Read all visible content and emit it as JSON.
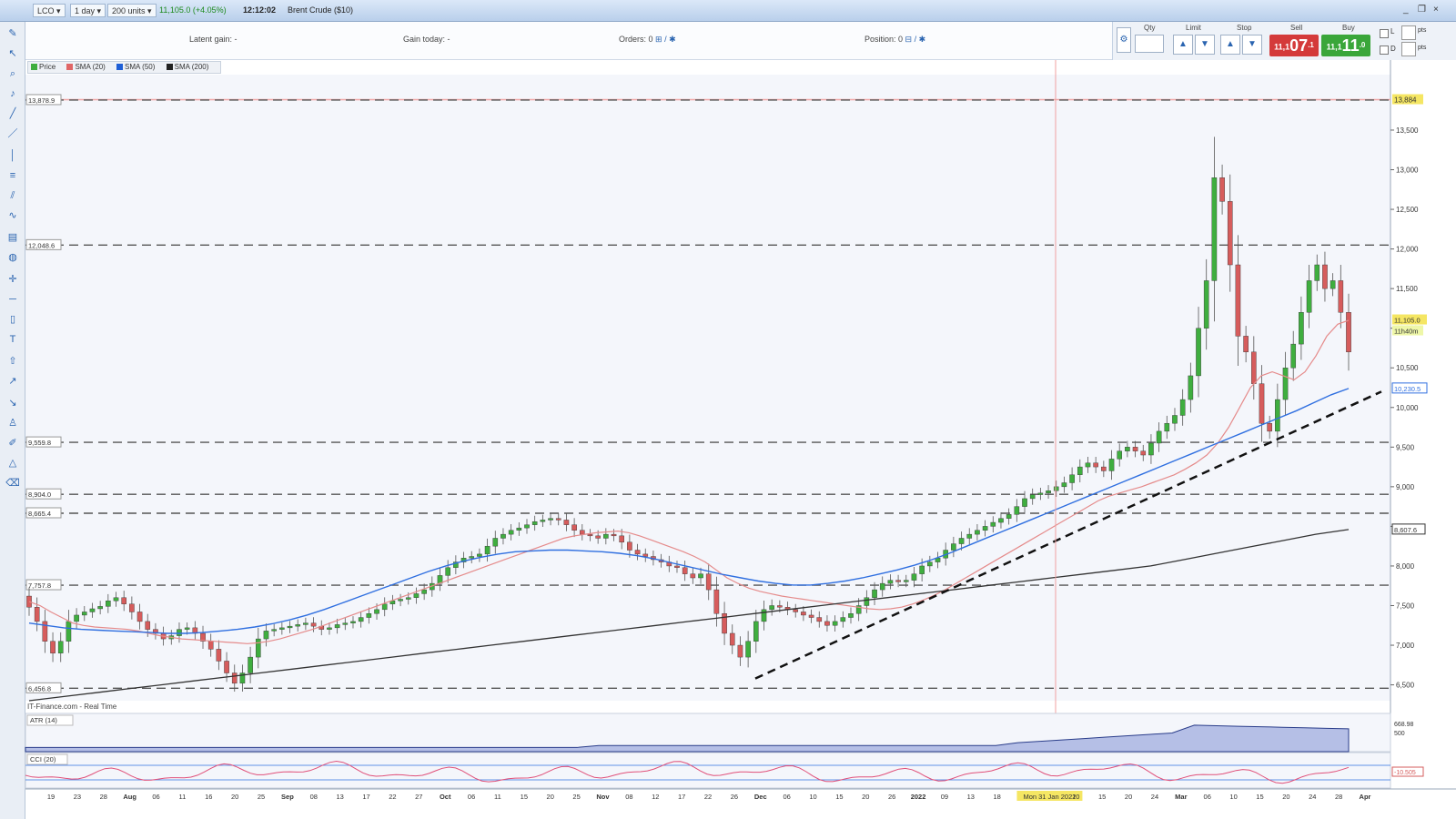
{
  "title_bar": {
    "instrument_code": "LCO",
    "timeframe": "1 day",
    "bar_count": "200 units",
    "price_change": "11,105.0 (+4.05%)",
    "time": "12:12:02",
    "instrument_name": "Brent Crude ($10)",
    "window_controls": [
      "_",
      "❐",
      "×"
    ]
  },
  "info_bar": {
    "latent_gain": "Latent gain: -",
    "gain_today": "Gain today: -",
    "orders": "Orders: 0",
    "position": "Position: 0"
  },
  "ticket": {
    "qty_label": "Qty",
    "limit_label": "Limit",
    "stop_label": "Stop",
    "sell_label": "Sell",
    "buy_label": "Buy",
    "sell_prefix": "11,1",
    "sell_big": "07",
    "sell_suffix": ".1",
    "buy_prefix": "11,1",
    "buy_big": "11",
    "buy_suffix": ".0",
    "sell_color": "#d43a3a",
    "buy_color": "#3aa63a"
  },
  "right_controls": {
    "l_label": "L",
    "d_label": "D",
    "pts1": "pts",
    "pts2": "pts"
  },
  "legend": {
    "price": "Price",
    "sma20": "SMA (20)",
    "sma50": "SMA (50)",
    "sma200": "SMA (200)",
    "sma20_color": "#e06666",
    "sma50_color": "#1f5fd6",
    "sma200_color": "#222222"
  },
  "source_label": "IT-Finance.com - Real Time",
  "chart_data": [
    {
      "type": "candlestick",
      "title": "Brent Crude ($10) - LCO, 1 day",
      "ylim": [
        6300,
        14200
      ],
      "y_ticks": [
        {
          "value": 6500,
          "label": "6,500"
        },
        {
          "value": 7000,
          "label": "7,000"
        },
        {
          "value": 7500,
          "label": "7,500"
        },
        {
          "value": 8000,
          "label": "8,000"
        },
        {
          "value": 8500,
          "label": "8,500"
        },
        {
          "value": 9000,
          "label": "9,000"
        },
        {
          "value": 9500,
          "label": "9,500"
        },
        {
          "value": 10000,
          "label": "10,000"
        },
        {
          "value": 10500,
          "label": "10,500"
        },
        {
          "value": 11000,
          "label": "11,000"
        },
        {
          "value": 11500,
          "label": "11,500"
        },
        {
          "value": 12000,
          "label": "12,000"
        },
        {
          "value": 12500,
          "label": "12,500"
        },
        {
          "value": 13000,
          "label": "13,000"
        },
        {
          "value": 13500,
          "label": "13,500"
        }
      ],
      "x_ticks": [
        "19",
        "23",
        "28",
        "Aug",
        "06",
        "11",
        "16",
        "20",
        "25",
        "Sep",
        "08",
        "13",
        "17",
        "22",
        "27",
        "Oct",
        "06",
        "11",
        "15",
        "20",
        "25",
        "Nov",
        "08",
        "12",
        "17",
        "22",
        "26",
        "Dec",
        "06",
        "10",
        "15",
        "20",
        "26",
        "2022",
        "09",
        "13",
        "18",
        "23",
        "Mon 31 Jan 2022",
        "10",
        "15",
        "20",
        "24",
        "Mar",
        "06",
        "10",
        "15",
        "20",
        "24",
        "28",
        "Apr"
      ],
      "x_cursor_label": "Mon 31 Jan 2022",
      "horizontal_levels": [
        {
          "value": 13878.9,
          "label": "13,878.9"
        },
        {
          "value": 12048.6,
          "label": "12,048.6"
        },
        {
          "value": 9559.8,
          "label": "9,559.8"
        },
        {
          "value": 8904.0,
          "label": "8,904.0"
        },
        {
          "value": 8665.4,
          "label": "8,665.4"
        },
        {
          "value": 7757.8,
          "label": "7,757.8"
        },
        {
          "value": 6456.8,
          "label": "6,456.8"
        }
      ],
      "alert_line": {
        "value": 13884,
        "label": "13,884"
      },
      "current_price": {
        "value": 11105,
        "label": "11,105.0"
      },
      "countdown_label": "11h40m",
      "sma50_value_label": "10,230.5",
      "sma200_value_label": "8,607.6",
      "trendline": {
        "from": [
          "Dec 02",
          6580
        ],
        "to": [
          "Apr 01",
          10200
        ]
      },
      "series": [
        {
          "name": "Price",
          "open": [
            7620,
            7480,
            7300,
            7050,
            6900,
            7050,
            7300,
            7380,
            7420,
            7460,
            7490,
            7560,
            7600,
            7520,
            7420,
            7300,
            7200,
            7150,
            7080,
            7120,
            7200,
            7220,
            7150,
            7050,
            6950,
            6800,
            6650,
            6520,
            6650,
            6850,
            7080,
            7180,
            7200,
            7220,
            7240,
            7260,
            7280,
            7240,
            7200,
            7220,
            7260,
            7280,
            7300,
            7350,
            7400,
            7450,
            7520,
            7560,
            7580,
            7600,
            7650,
            7700,
            7780,
            7880,
            7980,
            8050,
            8100,
            8120,
            8150,
            8250,
            8350,
            8400,
            8450,
            8480,
            8520,
            8560,
            8580,
            8600,
            8580,
            8520,
            8450,
            8400,
            8380,
            8350,
            8400,
            8380,
            8300,
            8200,
            8150,
            8120,
            8080,
            8050,
            8000,
            7980,
            7900,
            7850,
            7900,
            7700,
            7400,
            7150,
            7000,
            6850,
            7050,
            7300,
            7450,
            7500,
            7480,
            7450,
            7420,
            7380,
            7350,
            7300,
            7250,
            7300,
            7350,
            7400,
            7500,
            7600,
            7700,
            7780,
            7820,
            7800,
            7820,
            7900,
            8000,
            8050,
            8100,
            8200,
            8280,
            8350,
            8400,
            8450,
            8500,
            8550,
            8600,
            8650,
            8750,
            8850,
            8900,
            8920,
            8950,
            9000,
            9050,
            9150,
            9250,
            9300,
            9250,
            9200,
            9350,
            9450,
            9500,
            9450,
            9400,
            9550,
            9700,
            9800,
            9900,
            10100,
            10400,
            11000,
            11600,
            12900,
            12600,
            11800,
            10900,
            10700,
            10300,
            9800,
            9700,
            10100,
            10500,
            10800,
            11200,
            11600,
            11800,
            11500,
            11600,
            11200
          ],
          "close": [
            7480,
            7300,
            7050,
            6900,
            7050,
            7300,
            7380,
            7420,
            7460,
            7490,
            7560,
            7600,
            7520,
            7420,
            7300,
            7200,
            7150,
            7080,
            7120,
            7200,
            7220,
            7150,
            7050,
            6950,
            6800,
            6650,
            6520,
            6650,
            6850,
            7080,
            7180,
            7200,
            7220,
            7240,
            7260,
            7280,
            7240,
            7200,
            7220,
            7260,
            7280,
            7300,
            7350,
            7400,
            7450,
            7520,
            7560,
            7580,
            7600,
            7650,
            7700,
            7780,
            7880,
            7980,
            8050,
            8100,
            8120,
            8150,
            8250,
            8350,
            8400,
            8450,
            8480,
            8520,
            8560,
            8580,
            8600,
            8580,
            8520,
            8450,
            8400,
            8380,
            8350,
            8400,
            8380,
            8300,
            8200,
            8150,
            8120,
            8080,
            8050,
            8000,
            7980,
            7900,
            7850,
            7900,
            7700,
            7400,
            7150,
            7000,
            6850,
            7050,
            7300,
            7450,
            7500,
            7480,
            7450,
            7420,
            7380,
            7350,
            7300,
            7250,
            7300,
            7350,
            7400,
            7500,
            7600,
            7700,
            7780,
            7820,
            7800,
            7820,
            7900,
            8000,
            8050,
            8100,
            8200,
            8280,
            8350,
            8400,
            8450,
            8500,
            8550,
            8600,
            8650,
            8750,
            8850,
            8900,
            8920,
            8950,
            9000,
            9050,
            9150,
            9250,
            9300,
            9250,
            9200,
            9350,
            9450,
            9500,
            9450,
            9400,
            9550,
            9700,
            9800,
            9900,
            10100,
            10400,
            11000,
            11600,
            12900,
            12600,
            11800,
            10900,
            10700,
            10300,
            9800,
            9700,
            10100,
            10500,
            10800,
            11200,
            11600,
            11800,
            11500,
            11600,
            11200,
            10700
          ]
        },
        {
          "name": "SMA (20)",
          "values": [
            7550,
            7500,
            7420,
            7350,
            7280,
            7250,
            7230,
            7220,
            7210,
            7200,
            7180,
            7150,
            7120,
            7100,
            7080,
            7070,
            7060,
            7050,
            7040,
            7030,
            7020,
            7030,
            7050,
            7080,
            7120,
            7160,
            7200,
            7250,
            7300,
            7350,
            7400,
            7450,
            7500,
            7550,
            7600,
            7650,
            7700,
            7750,
            7800,
            7850,
            7900,
            7950,
            8000,
            8050,
            8100,
            8150,
            8200,
            8250,
            8300,
            8350,
            8380,
            8400,
            8420,
            8430,
            8440,
            8420,
            8380,
            8330,
            8280,
            8230,
            8180,
            8120,
            8050,
            7950,
            7850,
            7780,
            7720,
            7680,
            7650,
            7620,
            7600,
            7580,
            7560,
            7540,
            7520,
            7500,
            7480,
            7460,
            7450,
            7460,
            7480,
            7520,
            7570,
            7630,
            7700,
            7780,
            7860,
            7940,
            8020,
            8100,
            8180,
            8260,
            8340,
            8420,
            8500,
            8580,
            8660,
            8740,
            8820,
            8880,
            8920,
            8960,
            9000,
            9050,
            9100,
            9150,
            9220,
            9300,
            9400,
            9550,
            9750,
            10000,
            10250,
            10400,
            10450,
            10400,
            10350,
            10450,
            10650,
            10900,
            11050,
            11100
          ]
        },
        {
          "name": "SMA (50)",
          "values": [
            7280,
            7250,
            7220,
            7200,
            7190,
            7180,
            7170,
            7160,
            7150,
            7150,
            7160,
            7180,
            7200,
            7230,
            7270,
            7320,
            7380,
            7450,
            7530,
            7610,
            7690,
            7770,
            7850,
            7930,
            8000,
            8060,
            8110,
            8150,
            8180,
            8190,
            8200,
            8200,
            8190,
            8180,
            8160,
            8130,
            8090,
            8040,
            7990,
            7940,
            7890,
            7850,
            7810,
            7780,
            7760,
            7760,
            7780,
            7810,
            7850,
            7900,
            7950,
            8010,
            8080,
            8160,
            8250,
            8340,
            8430,
            8520,
            8610,
            8700,
            8790,
            8880,
            8970,
            9060,
            9150,
            9240,
            9330,
            9420,
            9510,
            9600,
            9690,
            9780,
            9870,
            9960,
            10060,
            10160,
            10240
          ]
        },
        {
          "name": "SMA (200)",
          "values": [
            6300,
            6350,
            6400,
            6450,
            6500,
            6550,
            6600,
            6650,
            6700,
            6750,
            6800,
            6850,
            6900,
            6950,
            7000,
            7050,
            7100,
            7150,
            7200,
            7250,
            7300,
            7350,
            7400,
            7450,
            7500,
            7550,
            7600,
            7650,
            7700,
            7750,
            7800,
            7850,
            7900,
            7950,
            8000,
            8080,
            8160,
            8240,
            8320,
            8400,
            8460
          ]
        }
      ],
      "sub_panels": [
        {
          "name": "ATR (14)",
          "value_label": "668.98",
          "label_2": "500"
        },
        {
          "name": "CCI (20)",
          "value_label": "-10.505"
        }
      ]
    }
  ]
}
